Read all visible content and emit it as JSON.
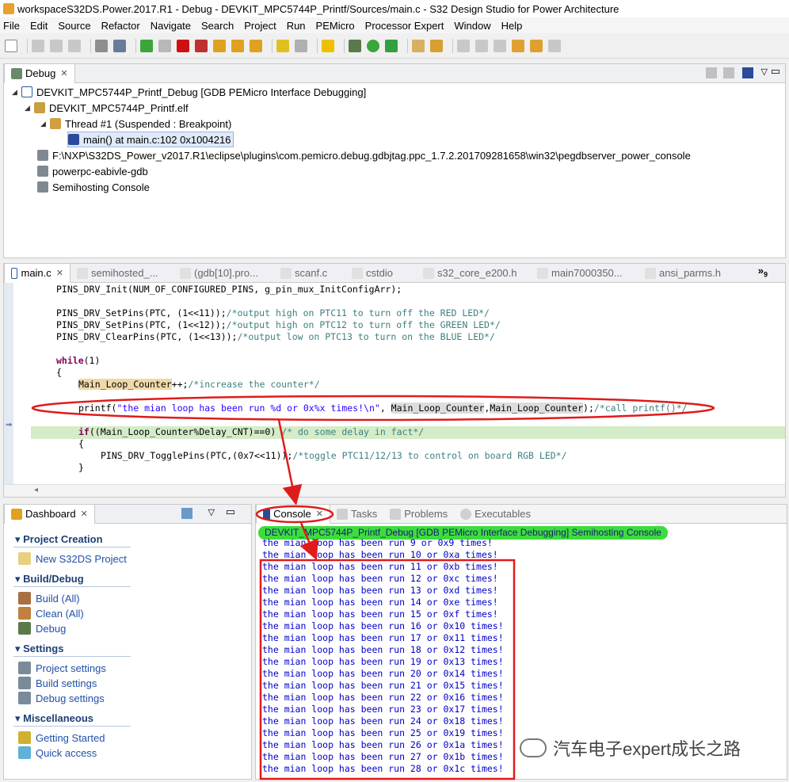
{
  "window": {
    "title": "workspaceS32DS.Power.2017.R1 - Debug - DEVKIT_MPC5744P_Printf/Sources/main.c - S32 Design Studio for Power Architecture"
  },
  "menu": [
    "File",
    "Edit",
    "Source",
    "Refactor",
    "Navigate",
    "Search",
    "Project",
    "Run",
    "PEMicro",
    "Processor Expert",
    "Window",
    "Help"
  ],
  "debug_view": {
    "tab_label": "Debug",
    "tree": [
      "DEVKIT_MPC5744P_Printf_Debug [GDB PEMicro Interface Debugging]",
      "DEVKIT_MPC5744P_Printf.elf",
      "Thread #1 (Suspended : Breakpoint)",
      "main() at main.c:102 0x1004216",
      "F:\\NXP\\S32DS_Power_v2017.R1\\eclipse\\plugins\\com.pemicro.debug.gdbjtag.ppc_1.7.2.201709281658\\win32\\pegdbserver_power_console",
      "powerpc-eabivle-gdb",
      "Semihosting Console"
    ]
  },
  "editor": {
    "tabs": [
      "main.c",
      "semihosted_...",
      "(gdb[10].pro...",
      "scanf.c",
      "cstdio",
      "s32_core_e200.h",
      "main7000350...",
      "ansi_parms.h"
    ],
    "overflow_count": "9",
    "code": {
      "l1": "PINS_DRV_Init(NUM_OF_CONFIGURED_PINS, g_pin_mux_InitConfigArr);",
      "l2a": "PINS_DRV_SetPins(PTC, (1<<11));",
      "l2b": "/*output high on PTC11 to turn off the RED LED*/",
      "l3a": "PINS_DRV_SetPins(PTC, (1<<12));",
      "l3b": "/*output high on PTC12 to turn off the GREEN LED*/",
      "l4a": "PINS_DRV_ClearPins(PTC, (1<<13));",
      "l4b": "/*output low on PTC13 to turn on the BLUE LED*/",
      "l5kw": "while",
      "l5": "(1)",
      "l6": "{",
      "l7a": "Main_Loop_Counter",
      "l7b": "++;",
      "l7c": "/*increase the counter*/",
      "l8a": "printf(",
      "l8s": "\"the mian loop has been run %d or 0x%x times!\\n\"",
      "l8b": ", ",
      "l8c": "Main_Loop_Counter",
      "l8d": ",",
      "l8e": "Main_Loop_Counter",
      "l8f": ");",
      "l8g": "/*call printf()*/",
      "l9kw": "if",
      "l9": "((Main_Loop_Counter%Delay_CNT)==0)",
      "l9c": "/* do some delay in fact*/",
      "l10": "{",
      "l11a": "PINS_DRV_TogglePins(PTC,(0x7<<11));",
      "l11b": "/*toggle PTC11/12/13 to control on board RGB LED*/",
      "l12": "}"
    }
  },
  "dashboard": {
    "tab_label": "Dashboard",
    "sections": [
      {
        "title": "Project Creation",
        "items": [
          "New S32DS Project"
        ]
      },
      {
        "title": "Build/Debug",
        "items": [
          "Build  (All)",
          "Clean  (All)",
          "Debug"
        ]
      },
      {
        "title": "Settings",
        "items": [
          "Project settings",
          "Build settings",
          "Debug settings"
        ]
      },
      {
        "title": "Miscellaneous",
        "items": [
          "Getting Started",
          "Quick access"
        ]
      }
    ]
  },
  "console": {
    "tabs": [
      "Console",
      "Tasks",
      "Problems",
      "Executables"
    ],
    "header": "DEVKIT_MPC5744P_Printf_Debug [GDB PEMicro Interface Debugging] Semihosting Console",
    "lines": [
      "the mian loop has been run 9 or 0x9 times!",
      "the mian loop has been run 10 or 0xa times!",
      "the mian loop has been run 11 or 0xb times!",
      "the mian loop has been run 12 or 0xc times!",
      "the mian loop has been run 13 or 0xd times!",
      "the mian loop has been run 14 or 0xe times!",
      "the mian loop has been run 15 or 0xf times!",
      "the mian loop has been run 16 or 0x10 times!",
      "the mian loop has been run 17 or 0x11 times!",
      "the mian loop has been run 18 or 0x12 times!",
      "the mian loop has been run 19 or 0x13 times!",
      "the mian loop has been run 20 or 0x14 times!",
      "the mian loop has been run 21 or 0x15 times!",
      "the mian loop has been run 22 or 0x16 times!",
      "the mian loop has been run 23 or 0x17 times!",
      "the mian loop has been run 24 or 0x18 times!",
      "the mian loop has been run 25 or 0x19 times!",
      "the mian loop has been run 26 or 0x1a times!",
      "the mian loop has been run 27 or 0x1b times!",
      "the mian loop has been run 28 or 0x1c times!"
    ]
  },
  "watermark": "汽车电子expert成长之路",
  "colors": {
    "annotation_red": "#e01b1b",
    "console_header_highlight": "#3ddc3d",
    "console_text": "#0000c8",
    "current_line": "#d4ecc8"
  }
}
